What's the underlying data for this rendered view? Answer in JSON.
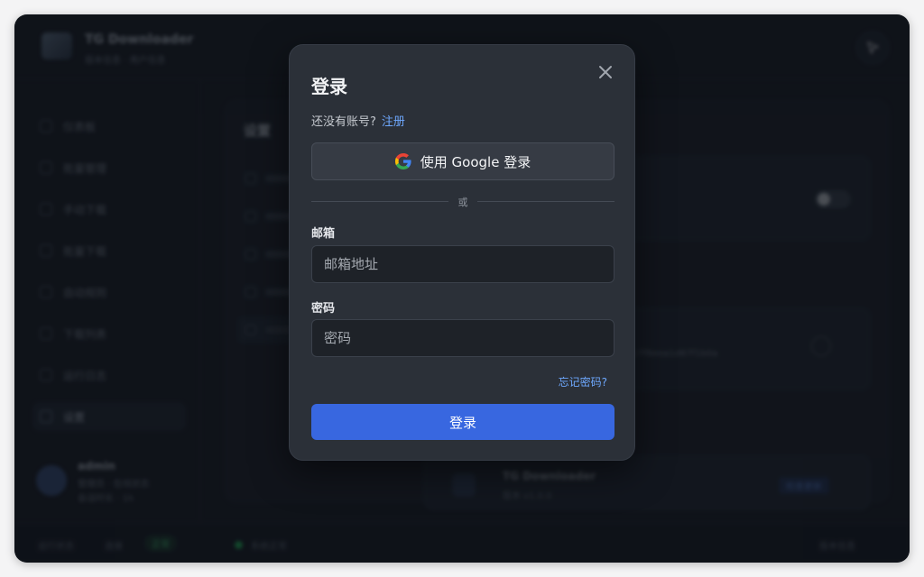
{
  "background_app": {
    "title": "TG Downloader",
    "subtitle": "版本信息 · 用户信息",
    "sidebar_items": [
      "仪表板",
      "批量管理",
      "手动下载",
      "批量下载",
      "自动规则",
      "下载列表",
      "运行日志",
      "设置"
    ],
    "active_item": "设置",
    "user": {
      "name": "admin",
      "meta1": "管理员 · 在线状态",
      "meta2": "会话时长 · 1h"
    },
    "panel_title": "设置",
    "card_title": "TG Downloader",
    "card_sub": "版本 v1.0.0",
    "card_text": "c7f8eea1d87f1b0a",
    "card_button": "检查更新",
    "status": {
      "left": "运行状态",
      "mid": "连接",
      "badge": "正常",
      "dot_text": "系统正常",
      "right": "版本信息"
    }
  },
  "modal": {
    "title": "登录",
    "no_account_text": "还没有账号?",
    "signup_link": "注册",
    "google_button": "使用 Google 登录",
    "divider_text": "或",
    "email_label": "邮箱",
    "email_placeholder": "邮箱地址",
    "email_value": "",
    "password_label": "密码",
    "password_placeholder": "密码",
    "password_value": "",
    "forgot_link": "忘记密码?",
    "submit_button": "登录"
  },
  "icons": {
    "close": "close-icon",
    "google": "google-logo-icon",
    "cursor": "cursor-arrow-icon"
  },
  "colors": {
    "accent": "#3867e0",
    "link": "#6ea8fe",
    "modal_bg": "#2b3038",
    "status_ok": "#22c55e"
  }
}
